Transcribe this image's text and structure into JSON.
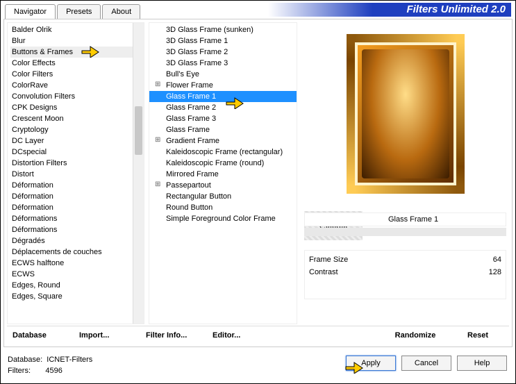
{
  "title": "Filters Unlimited 2.0",
  "tabs": [
    "Navigator",
    "Presets",
    "About"
  ],
  "categories": [
    "Balder Olrik",
    "Blur",
    "Buttons & Frames",
    "Color Effects",
    "Color Filters",
    "ColorRave",
    "Convolution Filters",
    "CPK Designs",
    "Crescent Moon",
    "Cryptology",
    "DC Layer",
    "DCspecial",
    "Distortion Filters",
    "Distort",
    "Déformation",
    "Déformation",
    "Déformation",
    "Déformations",
    "Déformations",
    "Dégradés",
    "Déplacements de couches",
    "ECWS halftone",
    "ECWS",
    "Edges, Round",
    "Edges, Square"
  ],
  "highlighted_category_index": 2,
  "filters": [
    {
      "label": "3D Glass Frame (sunken)",
      "exp": false
    },
    {
      "label": "3D Glass Frame 1",
      "exp": false
    },
    {
      "label": "3D Glass Frame 2",
      "exp": false
    },
    {
      "label": "3D Glass Frame 3",
      "exp": false
    },
    {
      "label": "Bull's Eye",
      "exp": false
    },
    {
      "label": "Flower Frame",
      "exp": true
    },
    {
      "label": "Glass Frame 1",
      "exp": false,
      "selected": true
    },
    {
      "label": "Glass Frame 2",
      "exp": false
    },
    {
      "label": "Glass Frame 3",
      "exp": false
    },
    {
      "label": "Glass Frame",
      "exp": false
    },
    {
      "label": "Gradient Frame",
      "exp": true
    },
    {
      "label": "Kaleidoscopic Frame (rectangular)",
      "exp": false
    },
    {
      "label": "Kaleidoscopic Frame (round)",
      "exp": false
    },
    {
      "label": "Mirrored Frame",
      "exp": false
    },
    {
      "label": "Passepartout",
      "exp": true
    },
    {
      "label": "Rectangular Button",
      "exp": false
    },
    {
      "label": "Round Button",
      "exp": false
    },
    {
      "label": "Simple Foreground Color Frame",
      "exp": false
    }
  ],
  "selected_filter_title": "Glass Frame 1",
  "params": [
    {
      "name": "Frame Size",
      "value": "64"
    },
    {
      "name": "Contrast",
      "value": "128"
    }
  ],
  "bottom_buttons_left": [
    "Database",
    "Import...",
    "Filter Info...",
    "Editor..."
  ],
  "bottom_buttons_right": [
    "Randomize",
    "Reset"
  ],
  "footer_info": {
    "db_label": "Database:",
    "db_value": "ICNET-Filters",
    "filters_label": "Filters:",
    "filters_value": "4596"
  },
  "footer_actions": [
    "Apply",
    "Cancel",
    "Help"
  ],
  "watermark": "Claudia"
}
